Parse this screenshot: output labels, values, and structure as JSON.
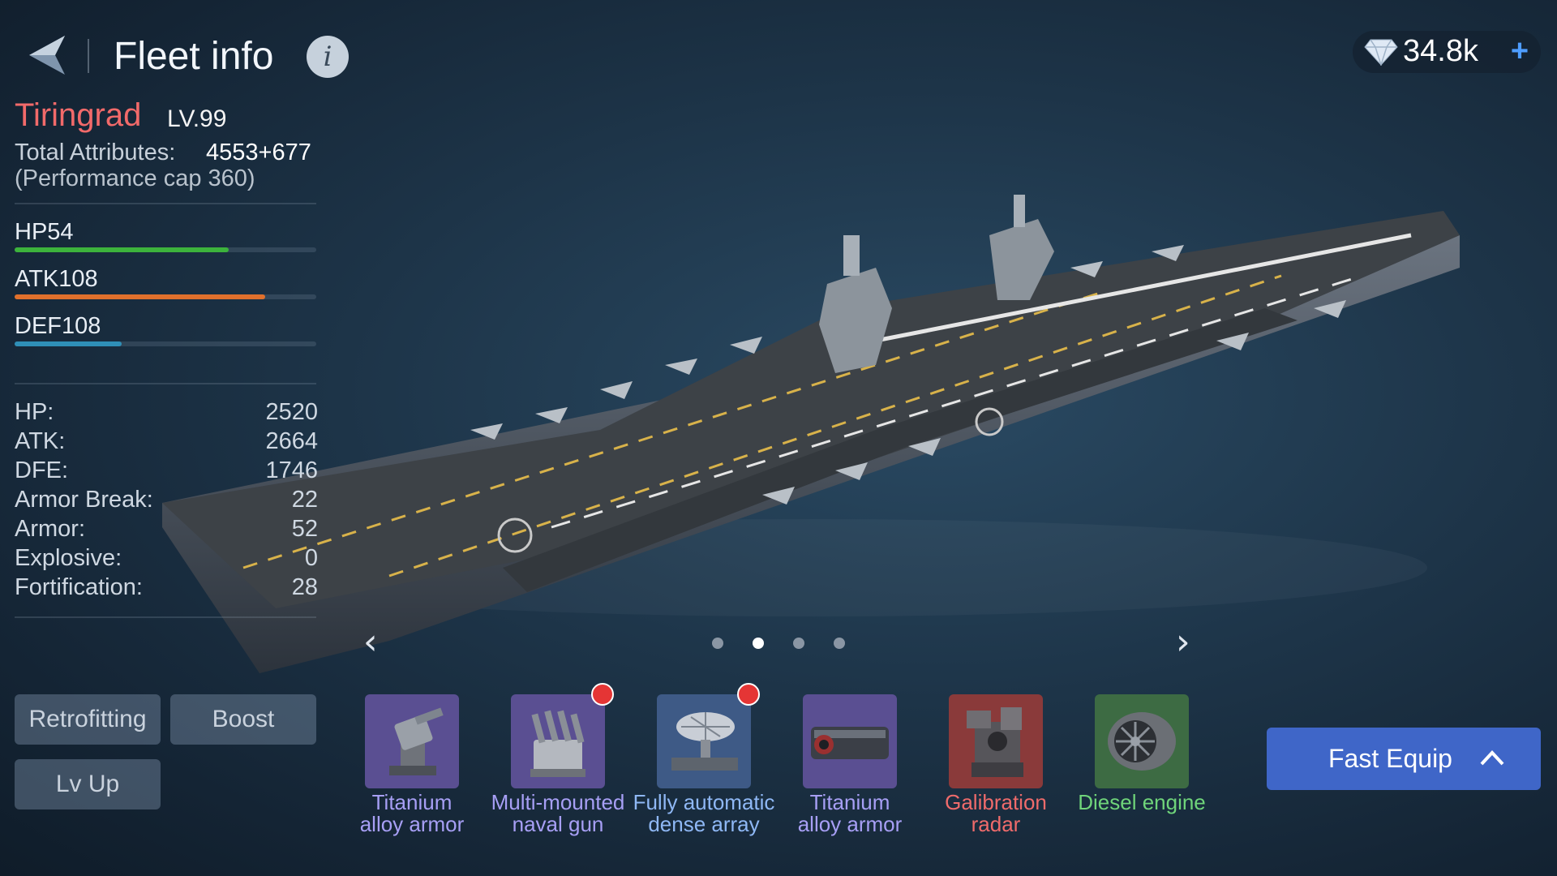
{
  "header": {
    "title": "Fleet info",
    "info_label": "i",
    "currency": {
      "amount": "34.8k",
      "plus_label": "+"
    }
  },
  "ship": {
    "name": "Tiringrad",
    "level": "LV.99",
    "total_attributes_label": "Total Attributes:",
    "total_attributes_value": "4553+677",
    "performance_cap": "(Performance cap 360)"
  },
  "bars": [
    {
      "label": "HP54",
      "fill": 0.71,
      "color": "#3cb33c"
    },
    {
      "label": "ATK108",
      "fill": 0.83,
      "color": "#e0702c"
    },
    {
      "label": "DEF108",
      "fill": 0.355,
      "color": "#2f8fb7"
    }
  ],
  "stats": [
    {
      "label": "HP:",
      "value": "2520"
    },
    {
      "label": "ATK:",
      "value": "2664"
    },
    {
      "label": "DFE:",
      "value": "1746"
    },
    {
      "label": "Armor Break:",
      "value": "22"
    },
    {
      "label": "Armor:",
      "value": "52"
    },
    {
      "label": "Explosive:",
      "value": "0"
    },
    {
      "label": "Fortification:",
      "value": "28"
    }
  ],
  "buttons": {
    "retrofitting": "Retrofitting",
    "boost": "Boost",
    "lv_up": "Lv Up"
  },
  "pager": {
    "prev": "‹",
    "next": "›",
    "pages": 4,
    "active_page": 2
  },
  "equipment": [
    {
      "line1": "Titanium",
      "line2": "alloy armor",
      "color": "#a79ff5",
      "bg": "#5a4f92",
      "icon": "turret-icon",
      "notify": false
    },
    {
      "line1": "Multi-mounted",
      "line2": "naval gun",
      "color": "#a79ff5",
      "bg": "#5a4f92",
      "icon": "naval-gun-icon",
      "notify": true
    },
    {
      "line1": "Fully automatic",
      "line2": "dense array",
      "color": "#8fb8f5",
      "bg": "#3e5a86",
      "icon": "radar-array-icon",
      "notify": true
    },
    {
      "line1": "Titanium",
      "line2": "alloy armor",
      "color": "#a79ff5",
      "bg": "#5a4f92",
      "icon": "armor-module-icon",
      "notify": false
    },
    {
      "line1": "Galibration",
      "line2": "radar",
      "color": "#ef6b6b",
      "bg": "#8a3a3a",
      "icon": "radar-machine-icon",
      "notify": false
    },
    {
      "line1": "Diesel engine",
      "line2": "",
      "color": "#6fd47a",
      "bg": "#3d6b43",
      "icon": "engine-icon",
      "notify": false
    }
  ],
  "fast_equip": {
    "label": "Fast Equip"
  }
}
